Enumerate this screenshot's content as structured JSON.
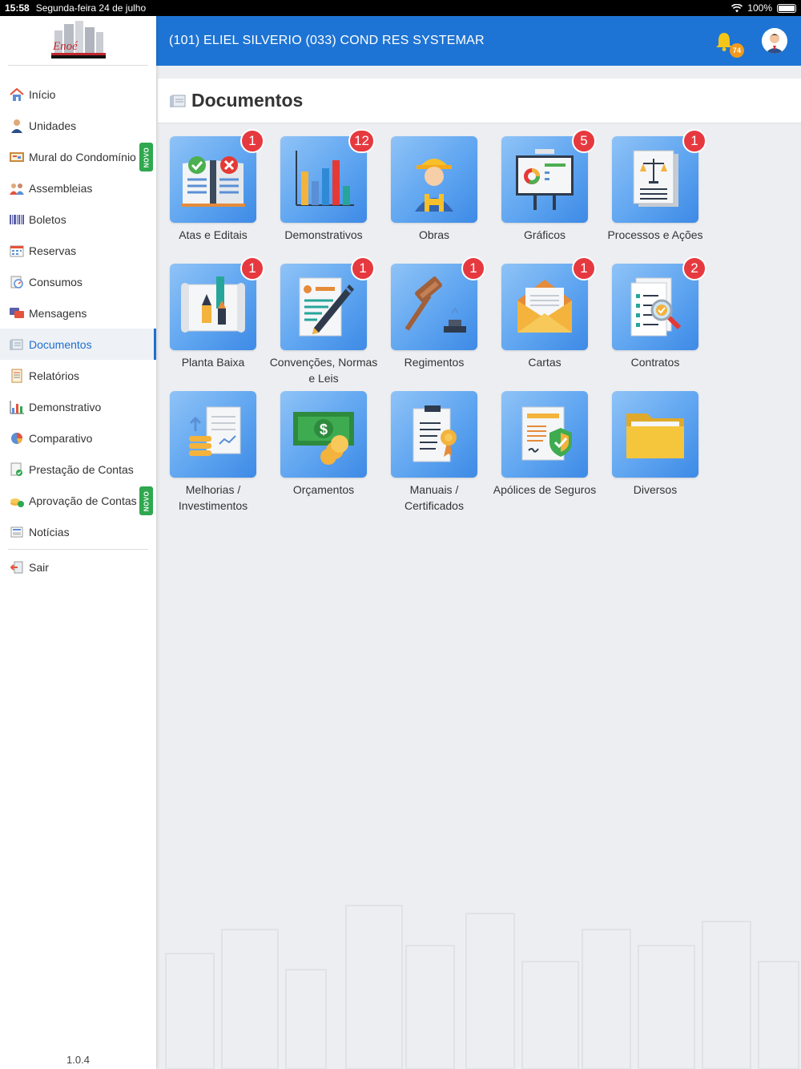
{
  "status_bar": {
    "time": "15:58",
    "date": "Segunda-feira 24 de julho",
    "battery": "100%"
  },
  "sidebar": {
    "logo_text": "Enoé",
    "logo_subtitle": "Administradora de Condomínios & Cia.",
    "items": [
      {
        "label": "Início",
        "icon": "home-icon"
      },
      {
        "label": "Unidades",
        "icon": "person-icon"
      },
      {
        "label": "Mural do Condomínio",
        "icon": "bulletin-board-icon",
        "badge": "NOVO"
      },
      {
        "label": "Assembleias",
        "icon": "people-icon"
      },
      {
        "label": "Boletos",
        "icon": "barcode-icon"
      },
      {
        "label": "Reservas",
        "icon": "calendar-icon"
      },
      {
        "label": "Consumos",
        "icon": "meter-icon"
      },
      {
        "label": "Mensagens",
        "icon": "chat-icon"
      },
      {
        "label": "Documentos",
        "icon": "documents-icon",
        "active": true
      },
      {
        "label": "Relatórios",
        "icon": "report-icon"
      },
      {
        "label": "Demonstrativo",
        "icon": "bar-chart-icon"
      },
      {
        "label": "Comparativo",
        "icon": "pie-chart-icon"
      },
      {
        "label": "Prestação de Contas",
        "icon": "accounts-icon"
      },
      {
        "label": "Aprovação de Contas",
        "icon": "coins-approve-icon",
        "badge": "NOVO"
      },
      {
        "label": "Notícias",
        "icon": "news-icon"
      }
    ],
    "logout": {
      "label": "Sair",
      "icon": "logout-icon"
    },
    "version": "1.0.4"
  },
  "header": {
    "title": "(101) ELIEL SILVERIO  (033) COND RES SYSTEMAR",
    "notifications_count": "74",
    "brand_color": "#1e74d4"
  },
  "page": {
    "title": "Documentos"
  },
  "tiles": [
    {
      "label": "Atas e Editais",
      "badge": "1",
      "icon": "book-icon"
    },
    {
      "label": "Demonstrativos",
      "badge": "12",
      "icon": "bar-chart-icon"
    },
    {
      "label": "Obras",
      "badge": "",
      "icon": "worker-icon"
    },
    {
      "label": "Gráficos",
      "badge": "5",
      "icon": "presentation-board-icon"
    },
    {
      "label": "Processos e Ações",
      "badge": "1",
      "icon": "scales-icon"
    },
    {
      "label": "Planta Baixa",
      "badge": "1",
      "icon": "blueprint-icon"
    },
    {
      "label": "Convenções, Normas e Leis",
      "badge": "1",
      "icon": "contract-pen-icon"
    },
    {
      "label": "Regimentos",
      "badge": "1",
      "icon": "gavel-icon"
    },
    {
      "label": "Cartas",
      "badge": "1",
      "icon": "envelope-icon"
    },
    {
      "label": "Contratos",
      "badge": "2",
      "icon": "checklist-magnifier-icon"
    },
    {
      "label": "Melhorias / Investimentos",
      "badge": "",
      "icon": "investment-icon"
    },
    {
      "label": "Orçamentos",
      "badge": "",
      "icon": "money-icon"
    },
    {
      "label": "Manuais / Certificados",
      "badge": "",
      "icon": "certificate-icon"
    },
    {
      "label": "Apólices de Seguros",
      "badge": "",
      "icon": "insurance-shield-icon"
    },
    {
      "label": "Diversos",
      "badge": "",
      "icon": "folder-icon"
    }
  ]
}
